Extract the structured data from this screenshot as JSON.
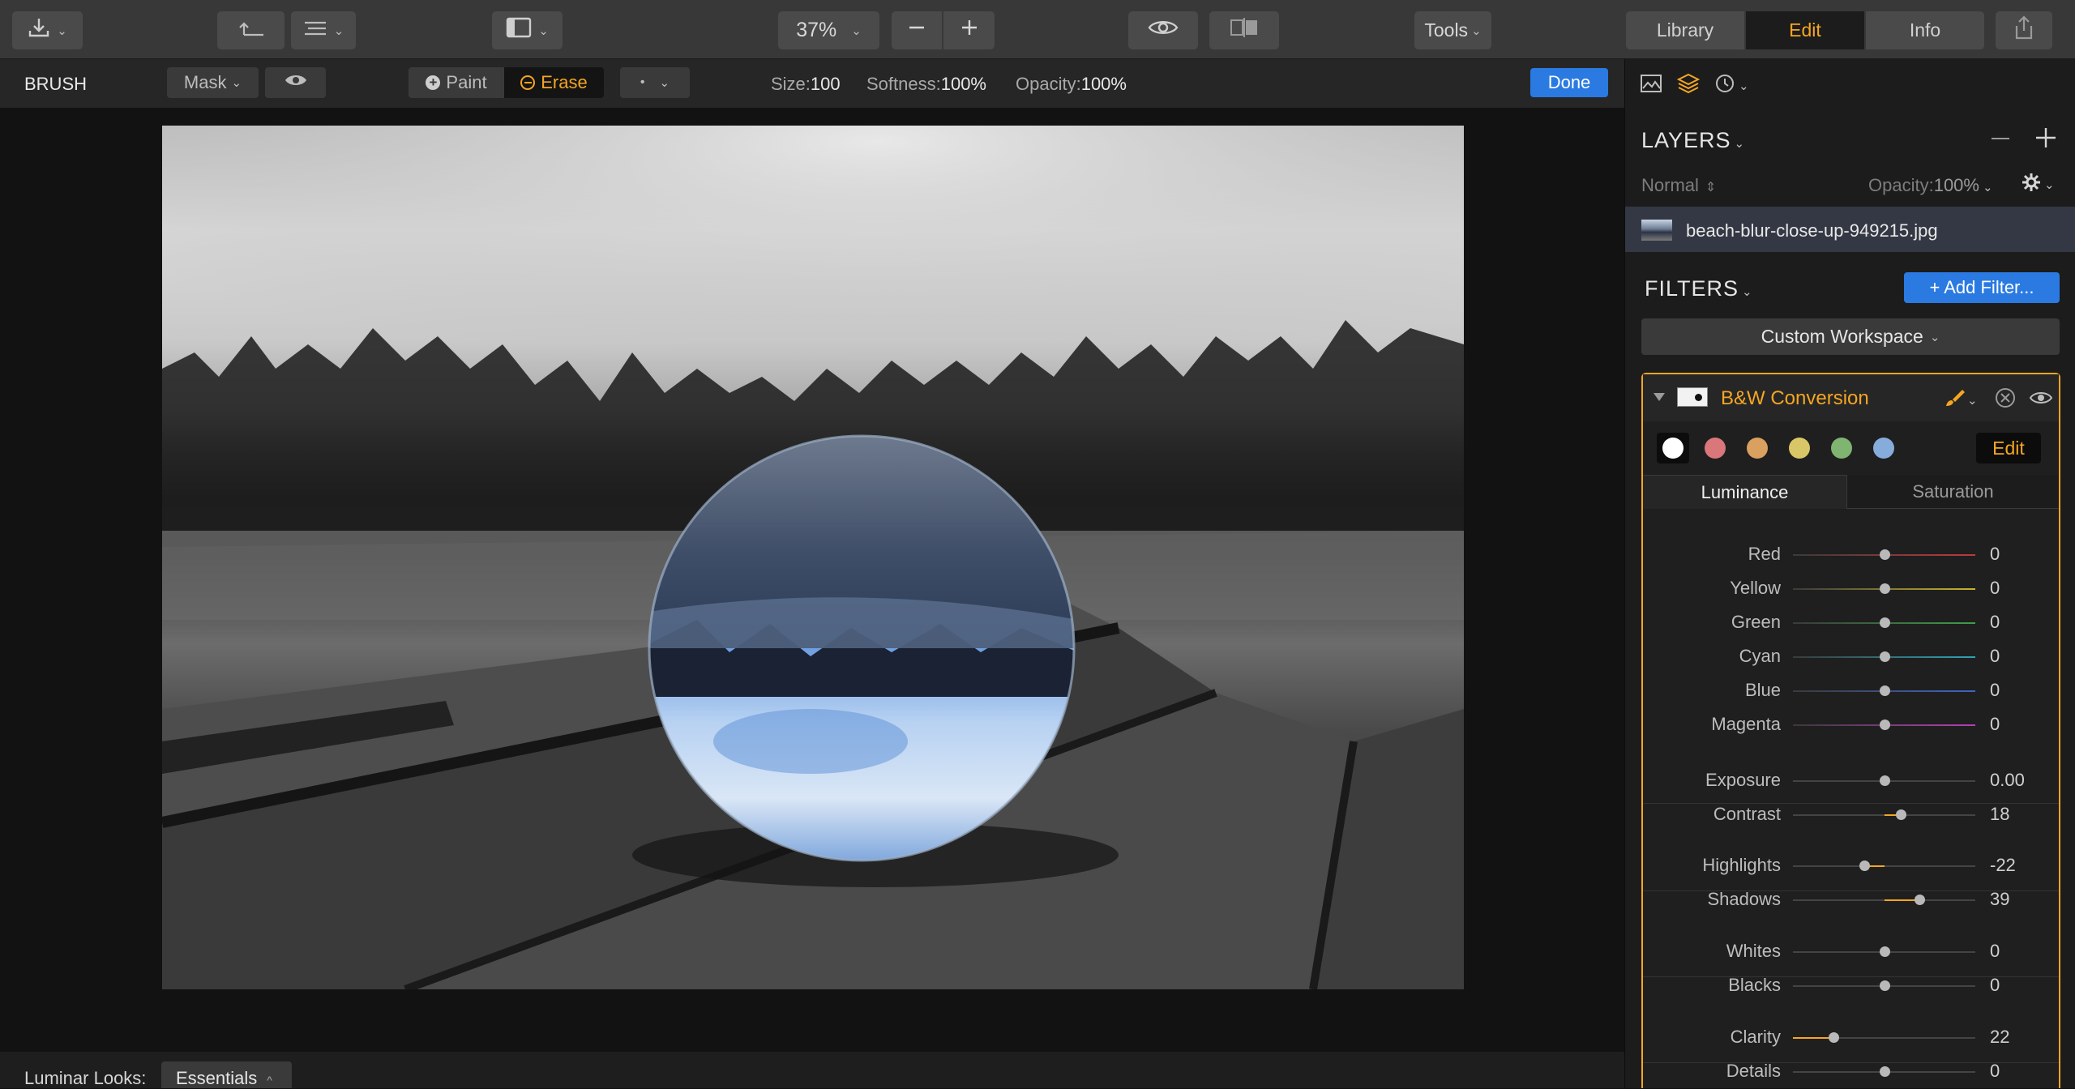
{
  "toolbar": {
    "zoom": "37%",
    "tools_label": "Tools",
    "tabs": [
      {
        "label": "Library"
      },
      {
        "label": "Edit"
      },
      {
        "label": "Info"
      }
    ]
  },
  "brush": {
    "title": "BRUSH",
    "mask_label": "Mask",
    "paint_label": "Paint",
    "erase_label": "Erase",
    "brush_dot": "•",
    "size_label": "Size:",
    "size_value": "100",
    "softness_label": "Softness:",
    "softness_value": "100%",
    "opacity_label": "Opacity:",
    "opacity_value": "100%",
    "done_label": "Done"
  },
  "bottom": {
    "looks_label": "Luminar Looks:",
    "looks_value": "Essentials"
  },
  "layers": {
    "title": "LAYERS",
    "blend_mode": "Normal",
    "opacity_label": "Opacity:",
    "opacity_value": "100%",
    "layer_name": "beach-blur-close-up-949215.jpg"
  },
  "filters": {
    "title": "FILTERS",
    "add_label": "+ Add Filter...",
    "workspace": "Custom Workspace",
    "filter_name": "B&W Conversion",
    "edit_label": "Edit",
    "tab_luminance": "Luminance",
    "tab_saturation": "Saturation",
    "swatch_colors": [
      "#ffffff",
      "#d9777a",
      "#d9a060",
      "#d9c666",
      "#7fb471",
      "#86acdb"
    ],
    "accent": "#f5a623",
    "rows": [
      {
        "label": "Red",
        "value": "0",
        "level": 0.5,
        "color": "#c0393b"
      },
      {
        "label": "Yellow",
        "value": "0",
        "level": 0.5,
        "color": "#c9b52c"
      },
      {
        "label": "Green",
        "value": "0",
        "level": 0.5,
        "color": "#3f9e49"
      },
      {
        "label": "Cyan",
        "value": "0",
        "level": 0.5,
        "color": "#2fa4b5"
      },
      {
        "label": "Blue",
        "value": "0",
        "level": 0.5,
        "color": "#3f66c4"
      },
      {
        "label": "Magenta",
        "value": "0",
        "level": 0.5,
        "color": "#b43fb5"
      },
      {
        "label": "Exposure",
        "value": "0.00",
        "level": 0.5,
        "color": ""
      },
      {
        "label": "Contrast",
        "value": "18",
        "level": 0.59,
        "color": ""
      },
      {
        "label": "Highlights",
        "value": "-22",
        "level": 0.39,
        "color": ""
      },
      {
        "label": "Shadows",
        "value": "39",
        "level": 0.695,
        "color": ""
      },
      {
        "label": "Whites",
        "value": "0",
        "level": 0.5,
        "color": ""
      },
      {
        "label": "Blacks",
        "value": "0",
        "level": 0.5,
        "color": ""
      },
      {
        "label": "Clarity",
        "value": "22",
        "level": 0.22,
        "color": ""
      },
      {
        "label": "Details",
        "value": "0",
        "level": 0.5,
        "color": ""
      }
    ]
  }
}
